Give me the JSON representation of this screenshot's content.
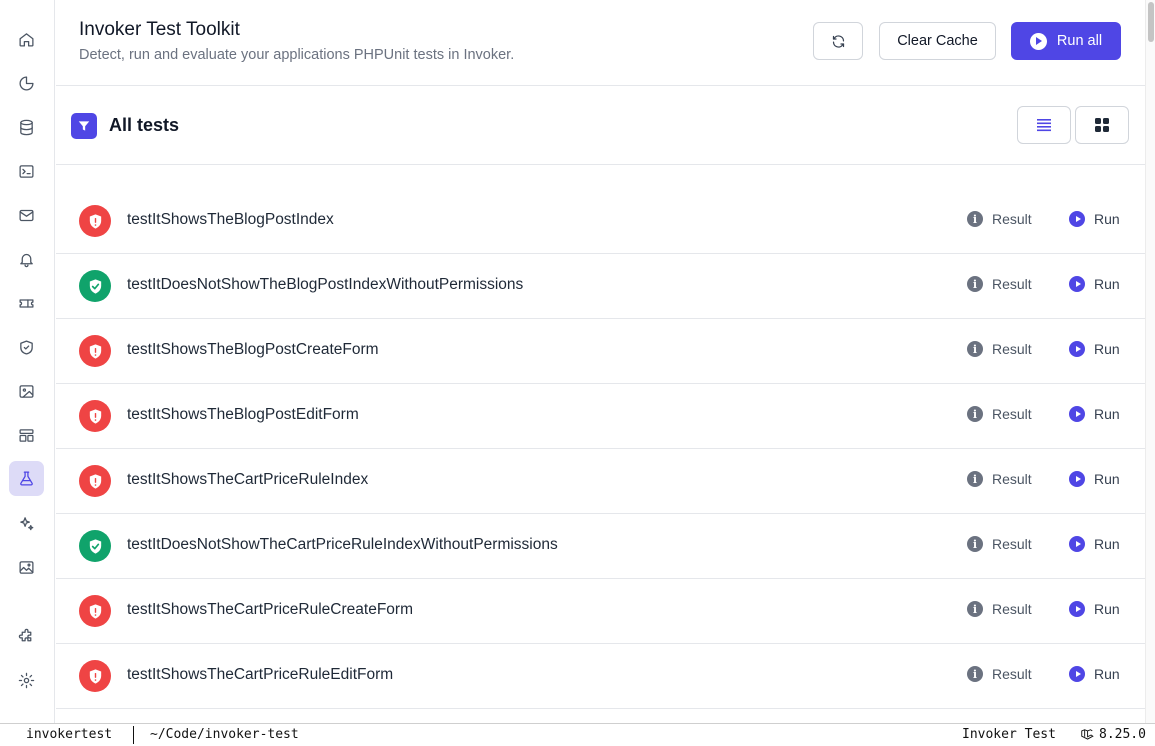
{
  "header": {
    "title": "Invoker Test Toolkit",
    "subtitle": "Detect, run and evaluate your applications PHPUnit tests in Invoker.",
    "clear_cache_label": "Clear Cache",
    "run_all_label": "Run all"
  },
  "toolbar": {
    "section_title": "All tests"
  },
  "tests": [
    {
      "name": "testItShowsTheBlogPostIndex",
      "status": "fail"
    },
    {
      "name": "testItDoesNotShowTheBlogPostIndexWithoutPermissions",
      "status": "pass"
    },
    {
      "name": "testItShowsTheBlogPostCreateForm",
      "status": "fail"
    },
    {
      "name": "testItShowsTheBlogPostEditForm",
      "status": "fail"
    },
    {
      "name": "testItShowsTheCartPriceRuleIndex",
      "status": "fail"
    },
    {
      "name": "testItDoesNotShowTheCartPriceRuleIndexWithoutPermissions",
      "status": "pass"
    },
    {
      "name": "testItShowsTheCartPriceRuleCreateForm",
      "status": "fail"
    },
    {
      "name": "testItShowsTheCartPriceRuleEditForm",
      "status": "fail"
    }
  ],
  "row_actions": {
    "result_label": "Result",
    "run_label": "Run"
  },
  "sidebar": {
    "items": [
      "home-icon",
      "pie-chart-icon",
      "database-icon",
      "terminal-icon",
      "mail-icon",
      "bell-icon",
      "ticket-icon",
      "shield-icon",
      "image-icon",
      "layout-icon",
      "flask-icon",
      "sparkles-icon",
      "photo-icon",
      "puzzle-icon",
      "settings-icon"
    ],
    "active": "flask-icon"
  },
  "statusbar": {
    "app": "invokertest",
    "path": "~/Code/invoker-test",
    "site": "Invoker Test",
    "version": "8.25.0"
  },
  "colors": {
    "accent": "#4f46e5",
    "fail": "#ef4444",
    "pass": "#10a36b"
  }
}
